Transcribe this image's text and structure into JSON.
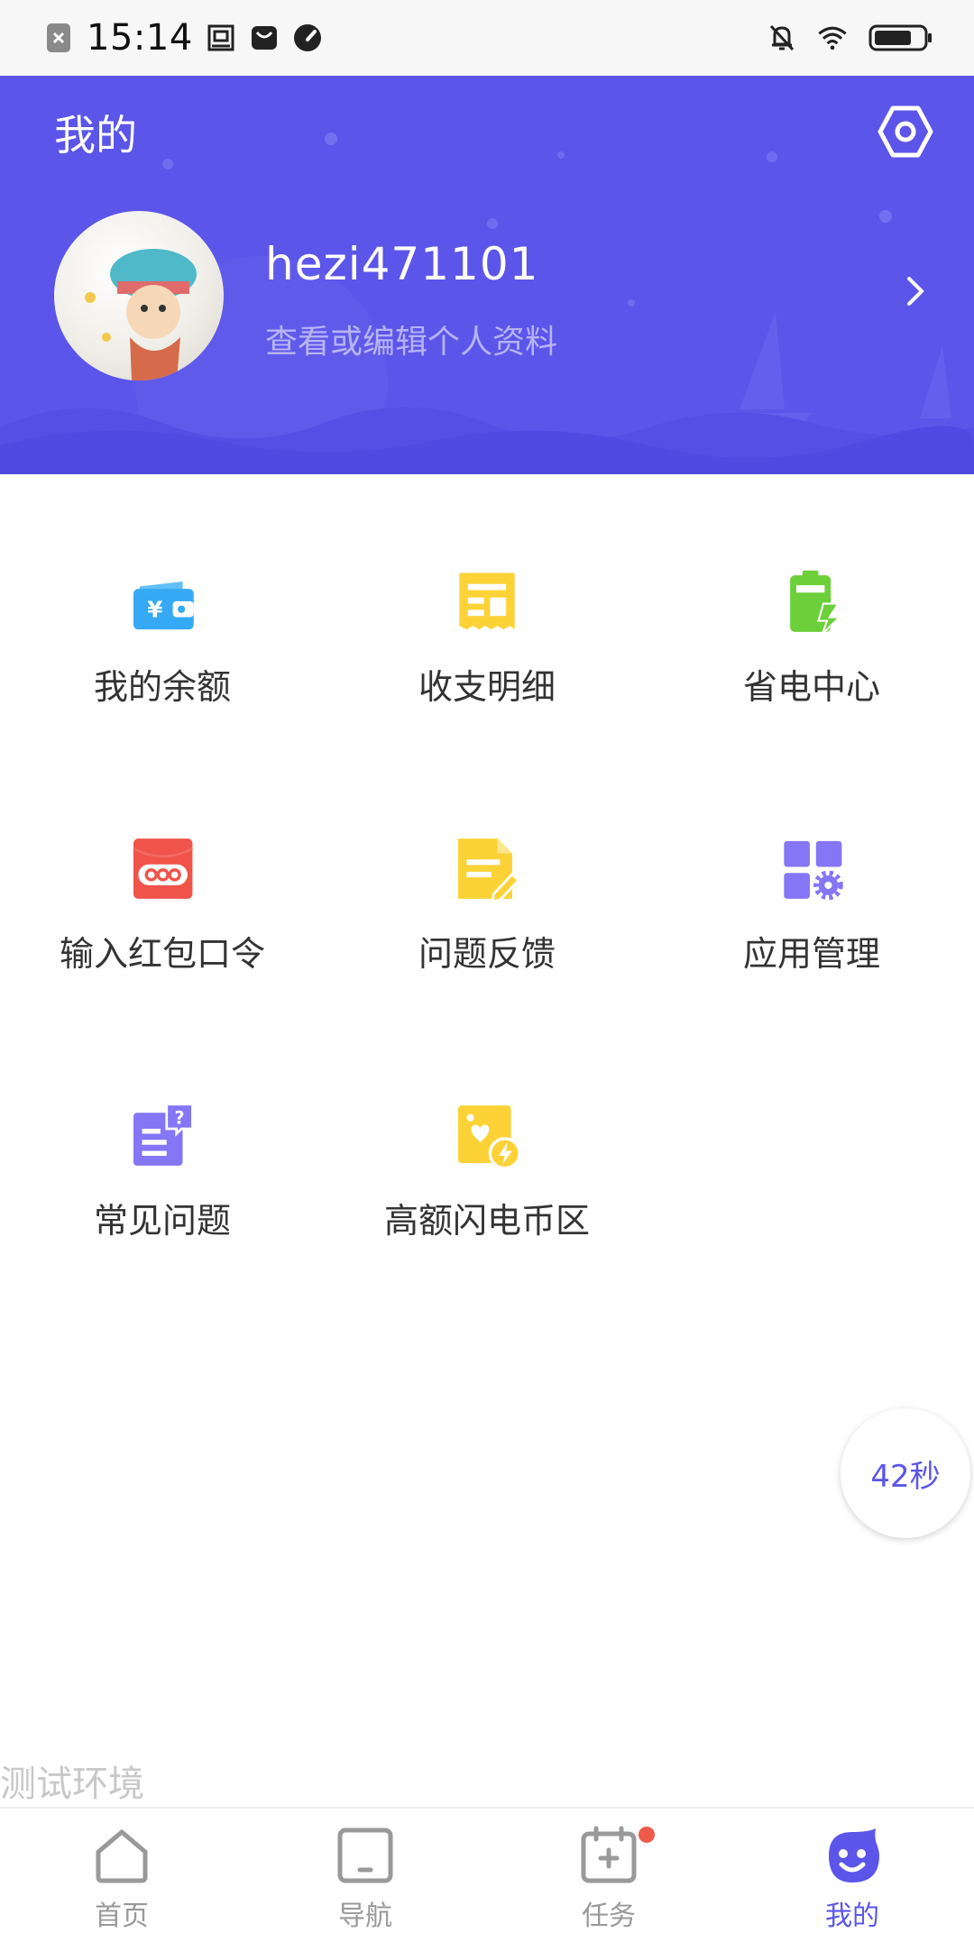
{
  "status_bar": {
    "time": "15:14",
    "icons": [
      "app-close-icon",
      "screenshot-icon",
      "mail-icon",
      "speedometer-icon",
      "mute-bell-icon",
      "wifi-icon",
      "battery-icon"
    ]
  },
  "header": {
    "title": "我的",
    "username": "hezi471101",
    "profile_hint": "查看或编辑个人资料",
    "accent_color": "#5b55ea"
  },
  "grid": [
    {
      "label": "我的余额",
      "icon": "wallet-icon",
      "color": "#35a9f3"
    },
    {
      "label": "收支明细",
      "icon": "receipt-icon",
      "color": "#fdd237"
    },
    {
      "label": "省电中心",
      "icon": "battery-bolt-icon",
      "color": "#6dcf3a"
    },
    {
      "label": "输入红包口令",
      "icon": "red-envelope-icon",
      "color": "#f0534a"
    },
    {
      "label": "问题反馈",
      "icon": "feedback-doc-icon",
      "color": "#fdd237"
    },
    {
      "label": "应用管理",
      "icon": "app-grid-gear-icon",
      "color": "#8476f5"
    },
    {
      "label": "常见问题",
      "icon": "faq-doc-icon",
      "color": "#8476f5"
    },
    {
      "label": "高额闪电币区",
      "icon": "photo-bolt-icon",
      "color": "#fdd237"
    }
  ],
  "timer_label": "42秒",
  "env_label": "测试环境",
  "bottom_nav": [
    {
      "label": "首页",
      "icon": "home-icon",
      "active": false
    },
    {
      "label": "导航",
      "icon": "tablet-icon",
      "active": false
    },
    {
      "label": "任务",
      "icon": "calendar-plus-icon",
      "active": false,
      "badge": true
    },
    {
      "label": "我的",
      "icon": "smiley-icon",
      "active": true
    }
  ]
}
